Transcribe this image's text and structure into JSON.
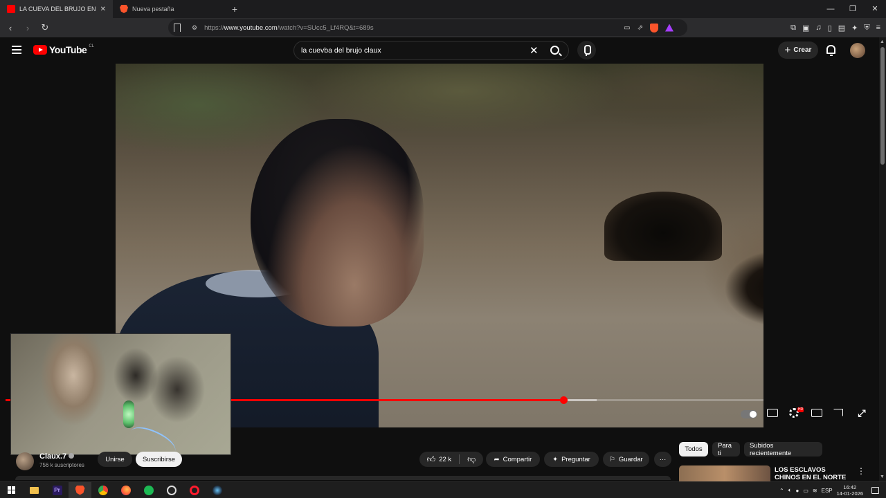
{
  "browser": {
    "tabs": [
      {
        "label": "LA CUEVA DEL BRUJO EN QU",
        "active": true,
        "icon": "youtube-icon"
      },
      {
        "label": "Nueva pestaña",
        "active": false,
        "icon": "brave-icon"
      }
    ],
    "new_tab": "+",
    "url_prefix": "https://",
    "url_host": "www.youtube.com",
    "url_path": "/watch?v=SUcc5_Lf4RQ&t=689s"
  },
  "youtube": {
    "logo_text": "YouTube",
    "country_code": "CL",
    "search_query": "la cuevba del brujo claux",
    "create_label": "Crear"
  },
  "player": {
    "progress_played": 0.7365,
    "progress_buffered": 0.78
  },
  "channel": {
    "name": "Claux.7",
    "subscribers": "756 k suscriptores",
    "join_label": "Unirse",
    "subscribe_label": "Suscribirse"
  },
  "actions": {
    "likes": "22 k",
    "share_label": "Compartir",
    "ask_label": "Preguntar",
    "save_label": "Guardar",
    "more_label": "···"
  },
  "filters": [
    "Todos",
    "Para ti",
    "Subidos recientemente"
  ],
  "recommendation": {
    "title": "LOS ESCLAVOS CHINOS EN EL NORTE DE CHILE"
  },
  "taskbar": {
    "lang": "ESP",
    "time": "16:42",
    "date": "14-01-2026"
  },
  "colors": {
    "accent": "#ff0000",
    "background": "#0f0f0f",
    "chip": "#272727"
  }
}
